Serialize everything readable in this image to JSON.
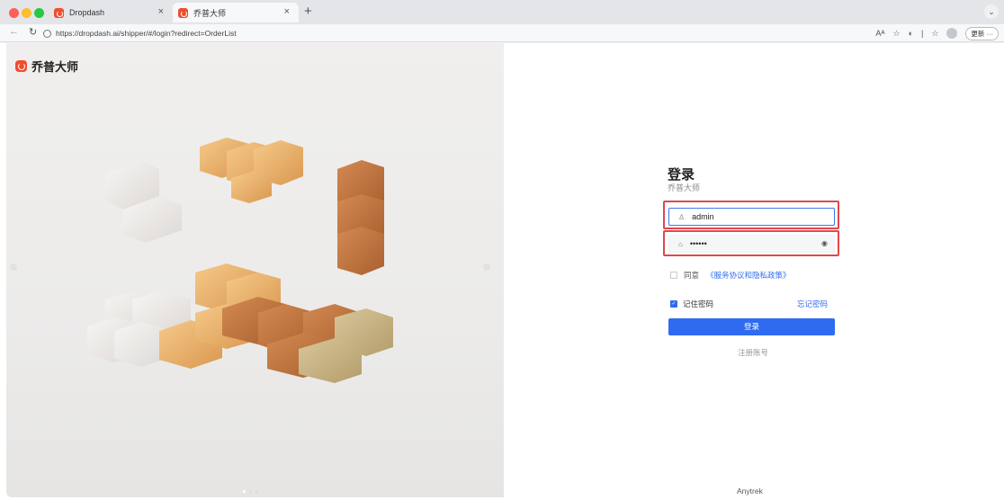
{
  "browser": {
    "tabs": [
      {
        "title": "Dropdash"
      },
      {
        "title": "乔普大师"
      }
    ],
    "new_tab": "+",
    "tab_close": "×",
    "tab_chevron": "⌄",
    "url": "https://dropdash.ai/shipper/#/login?redirect=OrderList",
    "update_label": "更新 ···",
    "reader_label": "Aᴬ"
  },
  "brand": {
    "name": "乔普大师"
  },
  "login": {
    "title": "登录",
    "subtitle": "乔普大师",
    "username_value": "admin",
    "password_value": "••••••",
    "agree_label": "同意",
    "agree_link": "《服务协议和隐私政策》",
    "remember_label": "记住密码",
    "forgot_label": "忘记密码",
    "submit_label": "登录",
    "register_label": "注册账号"
  },
  "footer": {
    "company": "Anytrek"
  },
  "colors": {
    "accent": "#2f6bf0",
    "highlight": "#e0474c",
    "brand": "#f04e2f"
  },
  "icons": [
    "user-icon",
    "lock-icon",
    "eye-off-icon",
    "reload-icon",
    "back-icon",
    "star-icon",
    "profile-icon"
  ]
}
